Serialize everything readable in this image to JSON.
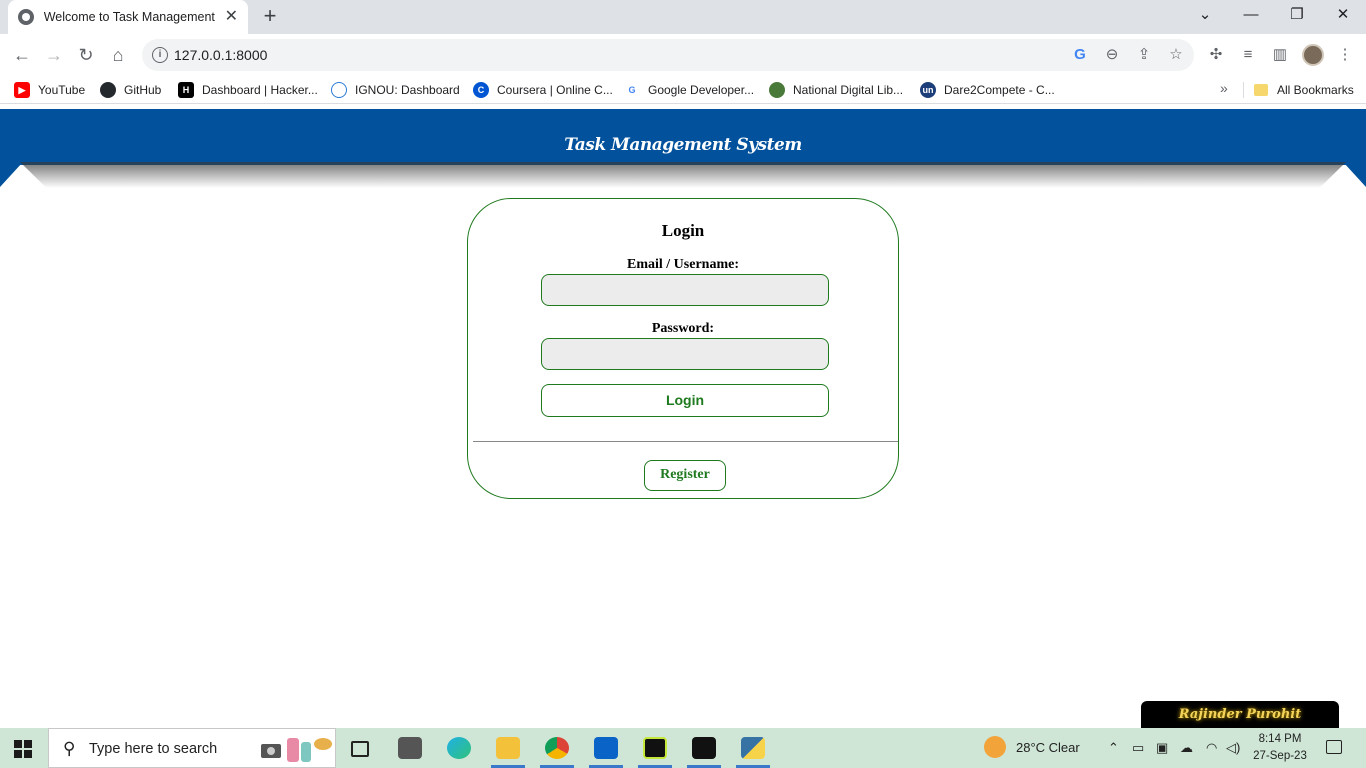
{
  "browser": {
    "tab_title": "Welcome to Task Management S",
    "url": "127.0.0.1:8000",
    "bookmarks": [
      {
        "label": "YouTube",
        "color": "#ff0000"
      },
      {
        "label": "GitHub",
        "color": "#24292e"
      },
      {
        "label": "Dashboard | Hacker...",
        "color": "#1ba94c"
      },
      {
        "label": "IGNOU: Dashboard",
        "color": "#2a7bd6"
      },
      {
        "label": "Coursera | Online C...",
        "color": "#0056d2"
      },
      {
        "label": "Google Developer...",
        "color": "#4285f4"
      },
      {
        "label": "National Digital Lib...",
        "color": "#4a7a3a"
      },
      {
        "label": "Dare2Compete - C...",
        "color": "#1c3f7a"
      }
    ],
    "all_bookmarks": "All Bookmarks"
  },
  "page": {
    "banner_title": "Task Management System",
    "login": {
      "title": "Login",
      "username_label": "Email / Username:",
      "password_label": "Password:",
      "login_button": "Login",
      "register_button": "Register"
    },
    "badge": "Rajinder Purohit",
    "colors": {
      "banner": "#01519c",
      "accent": "#1f7a1f"
    }
  },
  "taskbar": {
    "search_placeholder": "Type here to search",
    "weather": "28°C  Clear",
    "time": "8:14 PM",
    "date": "27-Sep-23"
  }
}
